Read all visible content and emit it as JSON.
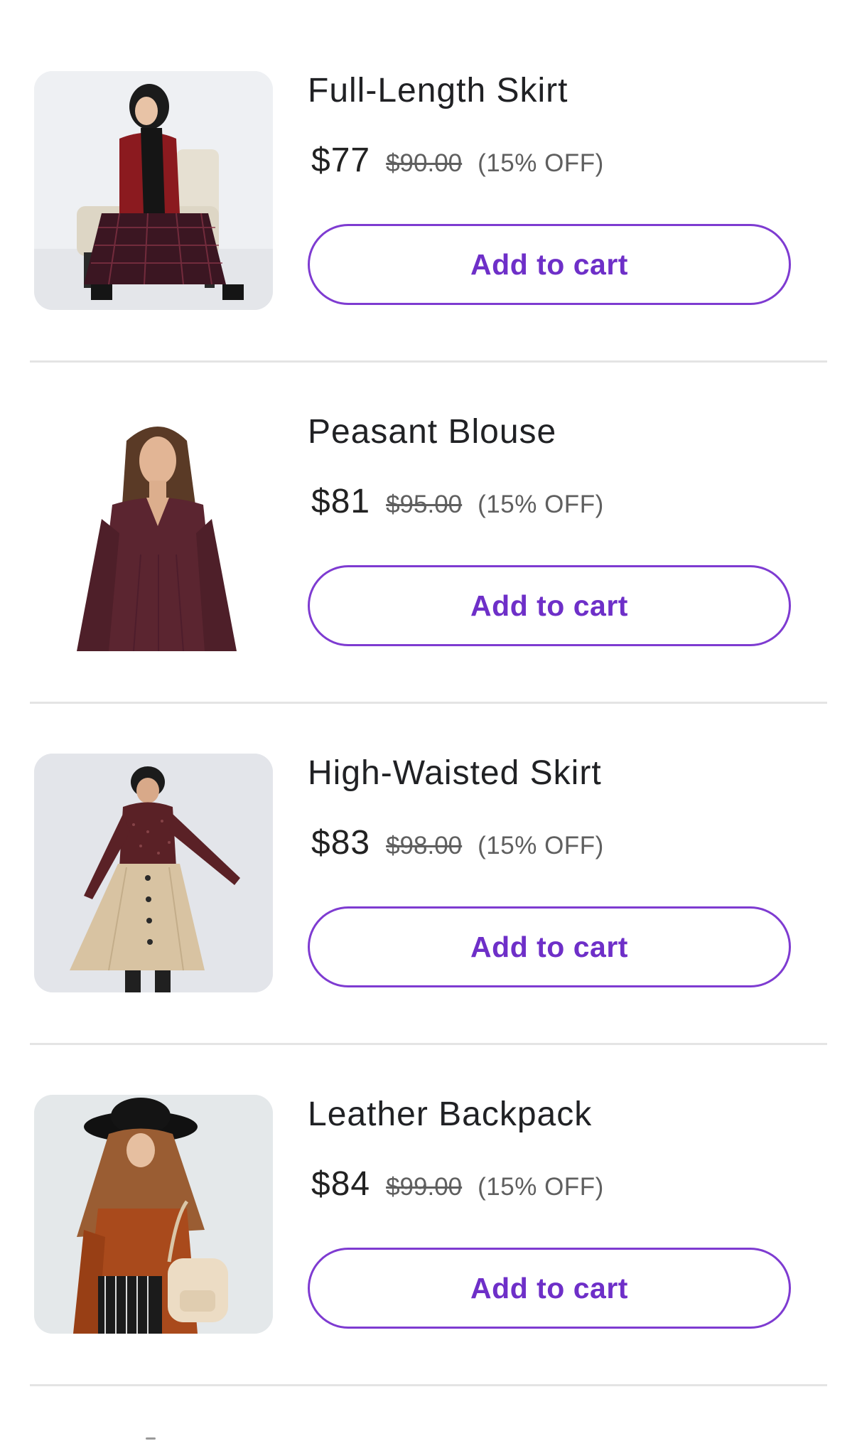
{
  "products": [
    {
      "title": "Full-Length Skirt",
      "price": "$77",
      "original_price": "$90.00",
      "discount": "(15% OFF)",
      "button_label": "Add to cart",
      "image": "model-seated-plaid-skirt"
    },
    {
      "title": "Peasant Blouse",
      "price": "$81",
      "original_price": "$95.00",
      "discount": "(15% OFF)",
      "button_label": "Add to cart",
      "image": "model-burgundy-blouse"
    },
    {
      "title": "High-Waisted Skirt",
      "price": "$83",
      "original_price": "$98.00",
      "discount": "(15% OFF)",
      "button_label": "Add to cart",
      "image": "model-khaki-button-skirt"
    },
    {
      "title": "Leather Backpack",
      "price": "$84",
      "original_price": "$99.00",
      "discount": "(15% OFF)",
      "button_label": "Add to cart",
      "image": "model-hat-backpack"
    }
  ],
  "colors": {
    "accent": "#6e2fc8",
    "button_border": "#7e3bd1",
    "divider": "#e4e4e4",
    "muted_text": "#5f5f5f"
  }
}
